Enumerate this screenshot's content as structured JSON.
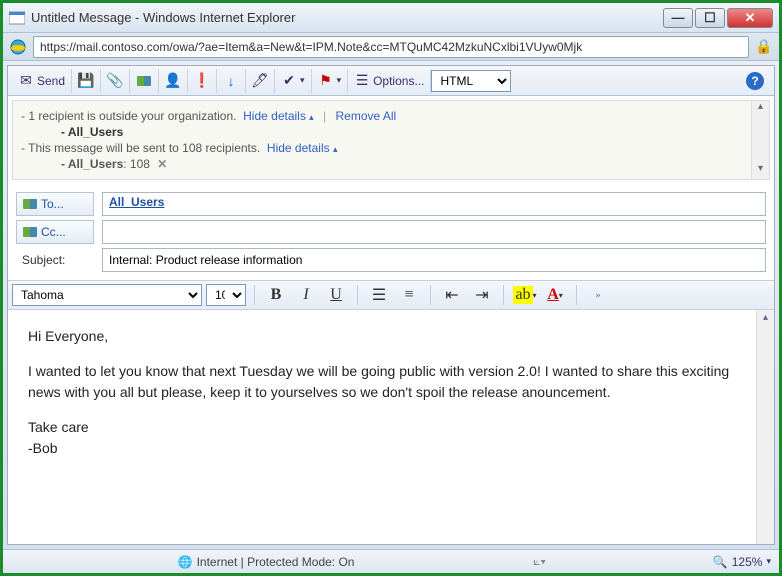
{
  "window": {
    "title": "Untitled Message - Windows Internet Explorer",
    "url": "https://mail.contoso.com/owa/?ae=Item&a=New&t=IPM.Note&cc=MTQuMC42MzkuNCxlbi1VUyw0Mjk"
  },
  "toolbar": {
    "send": "Send",
    "options": "Options...",
    "format_select": "HTML"
  },
  "mailtips": {
    "line1_prefix": "- 1 recipient is outside your organization.",
    "hide_details": "Hide details",
    "remove_all": "Remove All",
    "group1": "- All_Users",
    "line2_prefix": "- This message will be sent to 108 recipients.",
    "group2_name": "- All_Users",
    "group2_count": ": 108"
  },
  "fields": {
    "to_label": "To...",
    "to_value": "All_Users",
    "cc_label": "Cc...",
    "cc_value": "",
    "subject_label": "Subject:",
    "subject_value": "Internal: Product release information"
  },
  "format": {
    "font": "Tahoma",
    "size": "10"
  },
  "body": {
    "p1": "Hi Everyone,",
    "p2": "I wanted to let you know that next Tuesday we will be going public with version 2.0!  I wanted to share this exciting news with you all but please, keep it to yourselves so we don't spoil the release anouncement.",
    "p3": "Take care",
    "p4": "-Bob"
  },
  "status": {
    "zone": "Internet | Protected Mode: On",
    "zoom": "125%"
  }
}
